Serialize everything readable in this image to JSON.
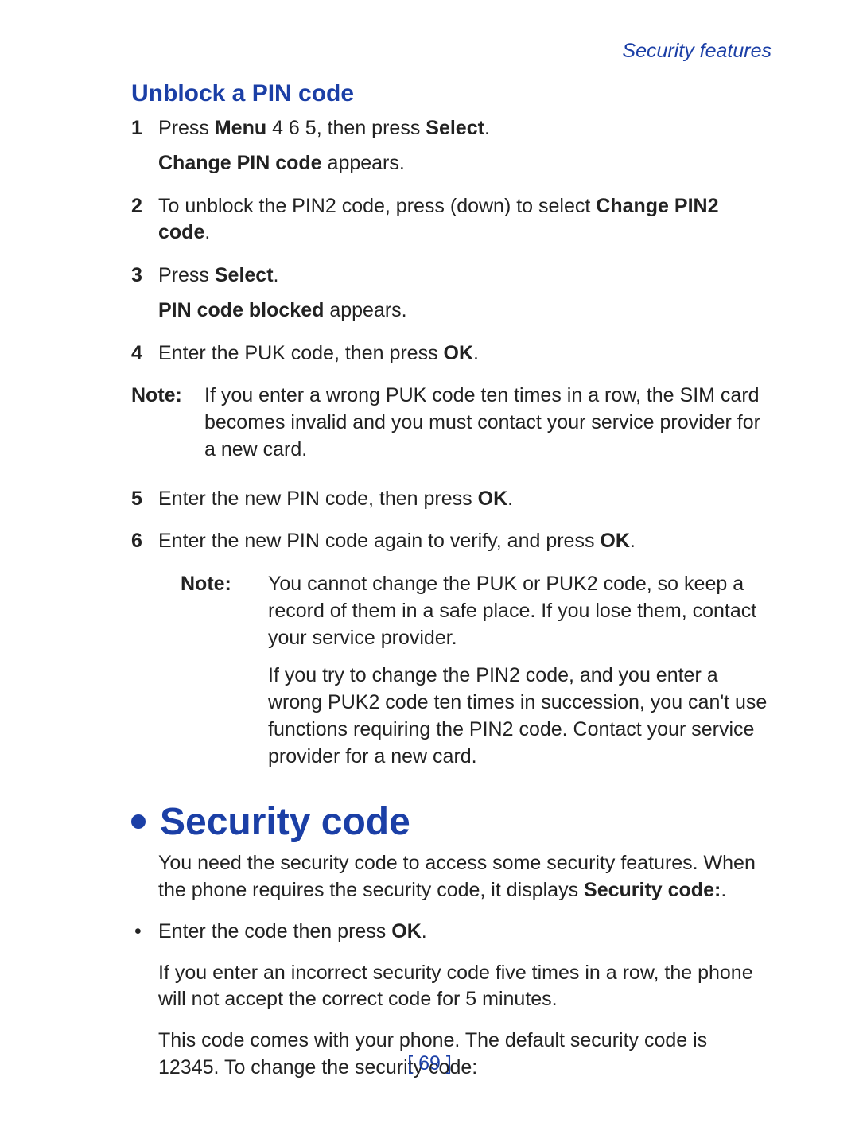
{
  "breadcrumb": "Security features",
  "subheading": "Unblock a PIN code",
  "steps": [
    {
      "n": "1",
      "lines": [
        "Press <b>Menu</b> 4 6 5, then press <b>Select</b>.",
        "<b>Change PIN code</b> appears."
      ]
    },
    {
      "n": "2",
      "lines": [
        "To unblock the PIN2 code, press (down) to select <b>Change PIN2 code</b>."
      ]
    },
    {
      "n": "3",
      "lines": [
        "Press <b>Select</b>.",
        "<b>PIN code blocked</b> appears."
      ]
    },
    {
      "n": "4",
      "lines": [
        "Enter the PUK code, then press <b>OK</b>."
      ]
    }
  ],
  "note1_label": "Note:",
  "note1_text": "If you enter a wrong PUK code ten times in a row, the SIM card becomes invalid and you must contact your service provider for a new card.",
  "steps2": [
    {
      "n": "5",
      "lines": [
        "Enter the new PIN code, then press <b>OK</b>."
      ]
    },
    {
      "n": "6",
      "lines": [
        "Enter the new PIN code again to verify, and press <b>OK</b>."
      ]
    }
  ],
  "note2_label": "Note:",
  "note2_paras": [
    "You cannot change the PUK or PUK2 code, so keep a record of them in a safe place. If you lose them, contact your service provider.",
    "If you try to change the PIN2 code, and you enter a wrong PUK2 code ten times in succession, you can't use functions requiring the PIN2 code. Contact your service provider for a new card."
  ],
  "section_head": "Security code",
  "sec_p1": "You need the security code to access some security features. When the phone requires the security code, it displays <b>Security code:</b>.",
  "sec_bullet": "Enter the code then press <b>OK</b>.",
  "sec_p2": "If you enter an incorrect security code five times in a row, the phone will not accept the correct code for 5 minutes.",
  "sec_p3": "This code comes with your phone. The default security code is 12345. To change the security code:",
  "page_number": "[ 69 ]"
}
